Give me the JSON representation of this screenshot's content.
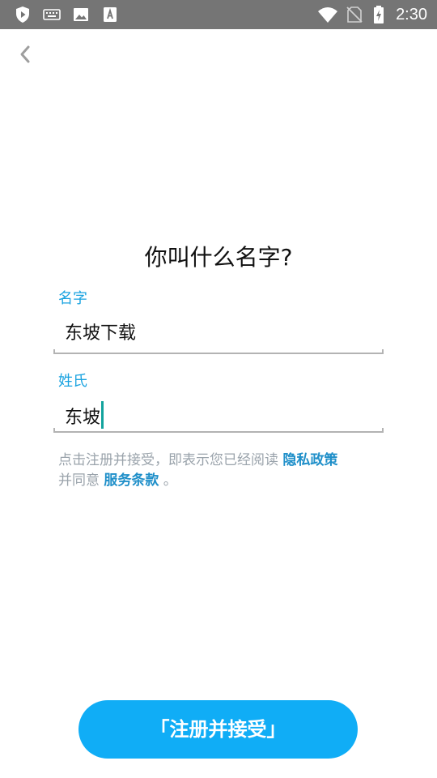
{
  "status_bar": {
    "time": "2:30",
    "left_icons": [
      "shield-play-icon",
      "keyboard-icon",
      "image-icon",
      "font-icon"
    ],
    "right_icons": [
      "wifi-icon",
      "no-sim-icon",
      "battery-charging-icon"
    ]
  },
  "header": {
    "back_icon": "chevron-left-icon"
  },
  "form": {
    "title": "你叫什么名字?",
    "first_name": {
      "label": "名字",
      "value": "东坡下载"
    },
    "last_name": {
      "label": "姓氏",
      "value": "东坡"
    }
  },
  "terms": {
    "prefix": "点击注册并接受，即表示您已经阅读 ",
    "privacy_link": "隐私政策",
    "middle": "并同意 ",
    "service_link": "服务条款",
    "suffix": " 。"
  },
  "register_button": {
    "label": "「注册并接受」"
  },
  "colors": {
    "accent": "#1aa3e0",
    "button": "#10adf6",
    "caret": "#13a39d",
    "status_bar": "#757575"
  }
}
